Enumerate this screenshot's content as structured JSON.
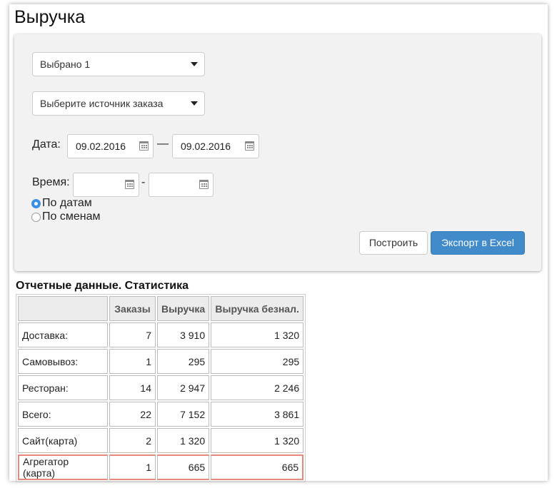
{
  "page": {
    "title": "Выручка"
  },
  "filters": {
    "select_restaurant": "Выбрано 1",
    "select_source": "Выберите источник заказа",
    "date_label": "Дата:",
    "date_from": "09.02.2016",
    "date_dash": "—",
    "date_to": "09.02.2016",
    "time_label": "Время:",
    "time_from": "",
    "time_dash": "-",
    "time_to": "",
    "radio_by_dates": "По датам",
    "radio_by_shifts": "По сменам",
    "build_button": "Построить",
    "export_button": "Экспорт в Excel"
  },
  "report": {
    "title": "Отчетные данные. Статистика",
    "headers": [
      "",
      "Заказы",
      "Выручка",
      "Выручка безнал."
    ],
    "rows": [
      [
        "Доставка:",
        "7",
        "3 910",
        "1 320"
      ],
      [
        "Самовывоз:",
        "1",
        "295",
        "295"
      ],
      [
        "Ресторан:",
        "14",
        "2 947",
        "2 246"
      ],
      [
        "Всего:",
        "22",
        "7 152",
        "3 861"
      ],
      [
        "Сайт(карта)",
        "2",
        "1 320",
        "1 320"
      ],
      [
        "Агрегатор (карта)",
        "1",
        "665",
        "665"
      ]
    ]
  },
  "colors": {
    "accent": "#428bca",
    "highlight_border": "#e8877c",
    "radio_checked": "#3a8ee6"
  }
}
